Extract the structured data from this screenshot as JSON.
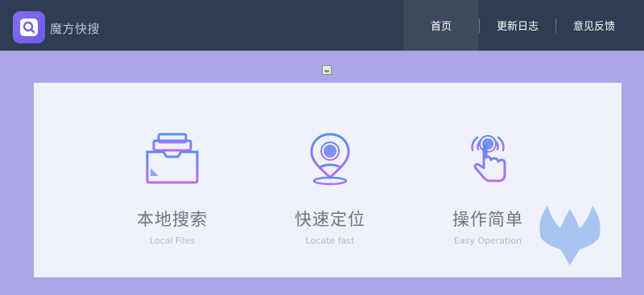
{
  "app": {
    "brand": "魔方快搜"
  },
  "nav": {
    "items": [
      {
        "label": "首页",
        "active": true
      },
      {
        "label": "更新日志",
        "active": false
      },
      {
        "label": "意见反馈",
        "active": false
      }
    ]
  },
  "features": [
    {
      "title": "本地搜索",
      "subtitle": "Local Files",
      "icon": "folder-inbox-icon"
    },
    {
      "title": "快速定位",
      "subtitle": "Locate fast",
      "icon": "map-pin-icon"
    },
    {
      "title": "操作简单",
      "subtitle": "Easy Operation",
      "icon": "tap-hand-icon"
    }
  ],
  "colors": {
    "topbar": "#2e3e52",
    "page_bg": "#aaa6e6",
    "panel_bg": "#f0f2fa",
    "icon_gradient_start": "#5b8cf5",
    "icon_gradient_end": "#b86cf0",
    "watermark": "#a8c4f0"
  }
}
